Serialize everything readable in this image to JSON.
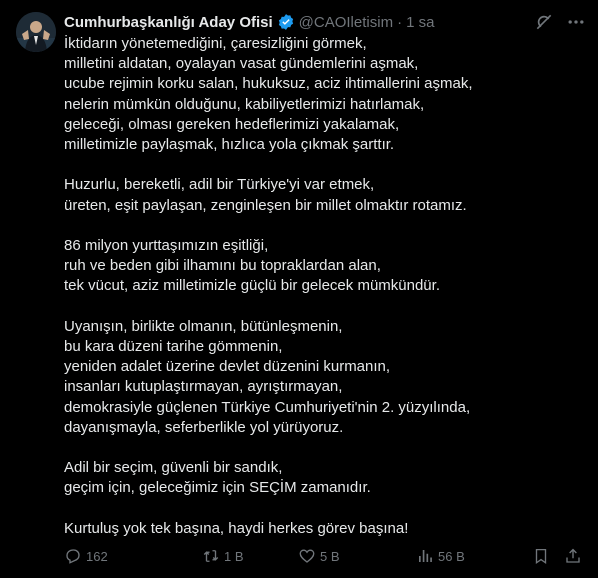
{
  "author": {
    "name": "Cumhurbaşkanlığı Aday Ofisi",
    "handle": "@CAOIletisim",
    "separator": "·",
    "time": "1 sa"
  },
  "tweet": {
    "paragraphs": [
      [
        "İktidarın yönetemediğini, çaresizliğini görmek,",
        "milletini aldatan, oyalayan vasat gündemlerini aşmak,",
        "ucube rejimin korku salan, hukuksuz, aciz ihtimallerini aşmak,",
        "nelerin mümkün olduğunu, kabiliyetlerimizi hatırlamak,",
        "geleceği, olması gereken hedeflerimizi yakalamak,",
        "milletimizle paylaşmak, hızlıca yola çıkmak şarttır."
      ],
      [
        "Huzurlu, bereketli, adil bir Türkiye'yi var etmek,",
        "üreten, eşit paylaşan, zenginleşen bir millet olmaktır rotamız."
      ],
      [
        "86 milyon yurttaşımızın eşitliği,",
        "ruh ve beden gibi ilhamını bu topraklardan alan,",
        "tek vücut, aziz milletimizle güçlü bir gelecek mümkündür."
      ],
      [
        "Uyanışın, birlikte olmanın, bütünleşmenin,",
        "bu kara düzeni tarihe gömmenin,",
        "yeniden adalet üzerine devlet düzenini kurmanın,",
        "insanları kutuplaştırmayan, ayrıştırmayan,",
        "demokrasiyle güçlenen Türkiye Cumhuriyeti'nin 2. yüzyılında,",
        "dayanışmayla, seferberlikle yol yürüyoruz."
      ],
      [
        "Adil bir seçim, güvenli bir sandık,",
        "geçim için, geleceğimiz için SEÇİM zamanıdır."
      ],
      [
        "Kurtuluş yok tek başına, haydi herkes görev başına!"
      ]
    ]
  },
  "stats": {
    "replies": "162",
    "reposts": "1 B",
    "likes": "5 B",
    "views": "56 B"
  },
  "colors": {
    "background": "#000000",
    "text": "#e7e9ea",
    "muted": "#71767b",
    "verified": "#1d9bf0"
  }
}
